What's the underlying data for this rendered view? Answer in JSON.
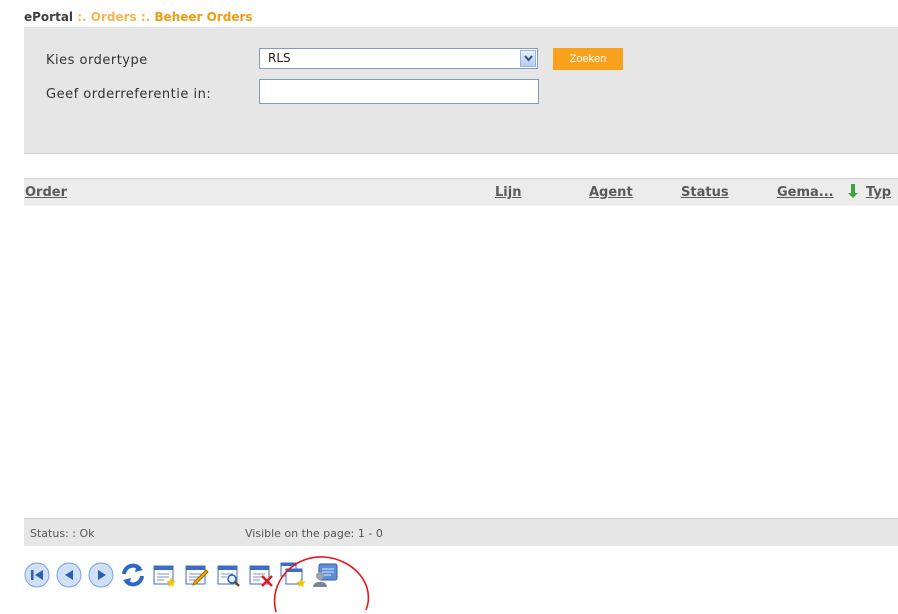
{
  "breadcrumb": {
    "home": "ePortal",
    "sep1": " :. ",
    "mid": "Orders",
    "sep2": " :. ",
    "current": "Beheer Orders"
  },
  "search": {
    "ordertype_label": "Kies ordertype",
    "ordertype_value": "RLS",
    "search_button": "Zoeken",
    "reference_label": "Geef orderreferentie in:",
    "reference_value": ""
  },
  "grid": {
    "columns": [
      "Order",
      "Lijn",
      "Agent",
      "Status",
      "Gema...",
      "Typ"
    ],
    "rows": []
  },
  "footer": {
    "status": "Status: : Ok",
    "visible": "Visible on the page: 1 - 0"
  },
  "toolbar": {
    "icons": [
      "first-page-icon",
      "previous-page-icon",
      "next-page-icon",
      "refresh-icon",
      "new-order-icon",
      "edit-order-icon",
      "view-order-icon",
      "delete-order-icon",
      "copy-order-icon",
      "user-details-icon"
    ]
  },
  "colors": {
    "accent": "#f7a11c",
    "panel": "#e6e6e6",
    "annotation": "#e8141c"
  }
}
